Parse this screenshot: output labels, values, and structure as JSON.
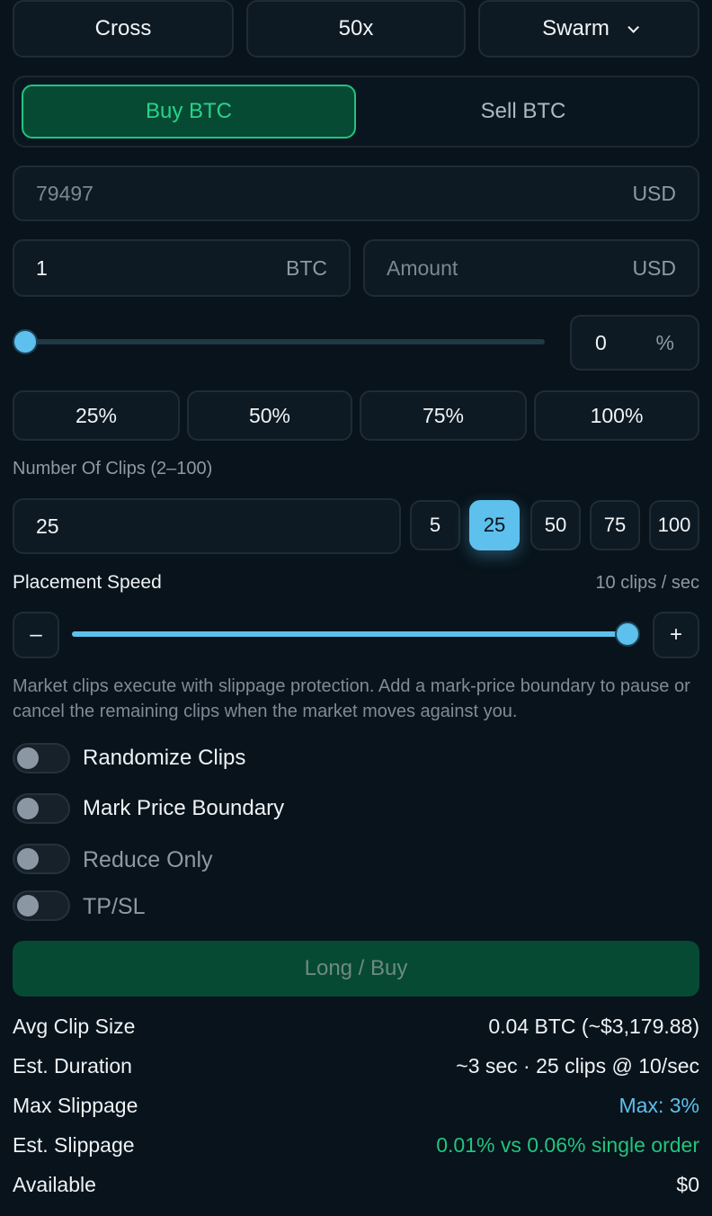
{
  "top": {
    "margin_mode": "Cross",
    "leverage": "50x",
    "order_type": "Swarm"
  },
  "side": {
    "buy_label": "Buy BTC",
    "sell_label": "Sell BTC"
  },
  "price": {
    "value": "79497",
    "unit": "USD"
  },
  "size": {
    "value": "1",
    "unit": "BTC"
  },
  "amount": {
    "placeholder": "Amount",
    "unit": "USD"
  },
  "size_slider": {
    "value_percent": 0,
    "display": "0",
    "unit": "%"
  },
  "quick_pct": [
    "25%",
    "50%",
    "75%",
    "100%"
  ],
  "clips": {
    "label": "Number Of Clips (2–100)",
    "value": "25",
    "presets": [
      "5",
      "25",
      "50",
      "75",
      "100"
    ],
    "selected": "25"
  },
  "speed": {
    "label": "Placement Speed",
    "readout": "10 clips / sec",
    "value_fraction": 1.0,
    "minus": "–",
    "plus": "+"
  },
  "note": "Market clips execute with slippage protection. Add a mark-price boundary to pause or cancel the remaining clips when the market moves against you.",
  "toggles": [
    {
      "label": "Randomize Clips",
      "on": false
    },
    {
      "label": "Mark Price Boundary",
      "on": false
    },
    {
      "label": "Reduce Only",
      "on": false
    },
    {
      "label": "TP/SL",
      "on": false
    }
  ],
  "submit_label": "Long / Buy",
  "summary": [
    {
      "key": "Avg Clip Size",
      "value": "0.04 BTC (~$3,179.88)",
      "color": "#eef2f5"
    },
    {
      "key": "Est. Duration",
      "value": "~3 sec · 25 clips @ 10/sec",
      "color": "#eef2f5"
    },
    {
      "key": "Max Slippage",
      "value": "Max: 3%",
      "color": "#5ec0ec"
    },
    {
      "key": "Est. Slippage",
      "value": "0.01% vs 0.06% single order",
      "color": "#22c47e"
    },
    {
      "key": "Available",
      "value": "$0",
      "color": "#eef2f5"
    }
  ],
  "colors": {
    "accent": "#5ec0ec",
    "buy": "#22c47e",
    "background": "#08131b"
  }
}
